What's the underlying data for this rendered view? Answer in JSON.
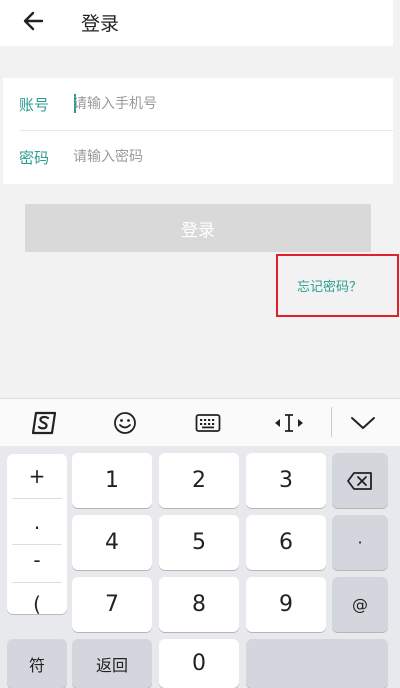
{
  "header": {
    "title": "登录",
    "back_icon": "arrow-left-icon"
  },
  "form": {
    "account_label": "账号",
    "account_placeholder": "请输入手机号",
    "password_label": "密码",
    "password_placeholder": "请输入密码"
  },
  "login_button": "登录",
  "forgot_password": "忘记密码？",
  "colors": {
    "accent": "#2a9d8f",
    "highlight": "#e0202a",
    "button_disabled": "#d9d9d9"
  },
  "keyboard": {
    "toolbar": [
      "sogou-logo-icon",
      "emoji-icon",
      "keyboard-icon",
      "cursor-move-icon",
      "collapse-chevron-icon"
    ],
    "symbols": [
      "+",
      ".",
      "-",
      "("
    ],
    "digits": {
      "one": "1",
      "two": "2",
      "three": "3",
      "four": "4",
      "five": "5",
      "six": "6",
      "seven": "7",
      "eight": "8",
      "nine": "9",
      "zero": "0"
    },
    "side": {
      "dot": "·",
      "at": "@"
    },
    "bottom": {
      "symbols": "符",
      "back": "返回"
    }
  }
}
